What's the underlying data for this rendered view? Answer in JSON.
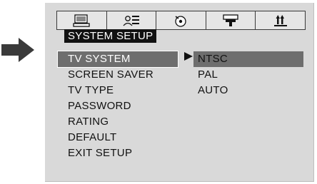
{
  "header": {
    "title": "SYSTEM SETUP"
  },
  "tabs": [
    {
      "icon": "monitor-icon"
    },
    {
      "icon": "speaker-list-icon"
    },
    {
      "icon": "disc-icon"
    },
    {
      "icon": "projector-icon"
    },
    {
      "icon": "audio-levels-icon"
    }
  ],
  "menu": {
    "items": [
      {
        "label": "TV SYSTEM",
        "selected": true
      },
      {
        "label": "SCREEN SAVER"
      },
      {
        "label": "TV TYPE"
      },
      {
        "label": "PASSWORD"
      },
      {
        "label": "RATING"
      },
      {
        "label": "DEFAULT"
      },
      {
        "label": "EXIT SETUP"
      }
    ]
  },
  "submenu": {
    "options": [
      {
        "label": "NTSC",
        "selected": true
      },
      {
        "label": "PAL"
      },
      {
        "label": "AUTO"
      }
    ]
  },
  "colors": {
    "panel": "#d9d9d9",
    "highlight": "#6e6e6e",
    "title_bg": "#111111",
    "text": "#111111"
  }
}
